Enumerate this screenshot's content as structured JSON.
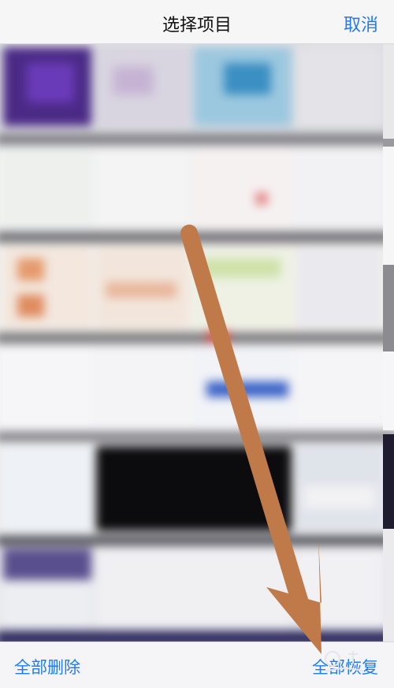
{
  "navbar": {
    "title": "选择项目",
    "cancel_label": "取消"
  },
  "toolbar": {
    "delete_all_label": "全部删除",
    "restore_all_label": "全部恢复"
  },
  "annotation": {
    "arrow_color": "#c07a4a",
    "arrow_icon": "arrow-down-right-icon"
  },
  "colors": {
    "accent": "#1d7cf2"
  }
}
